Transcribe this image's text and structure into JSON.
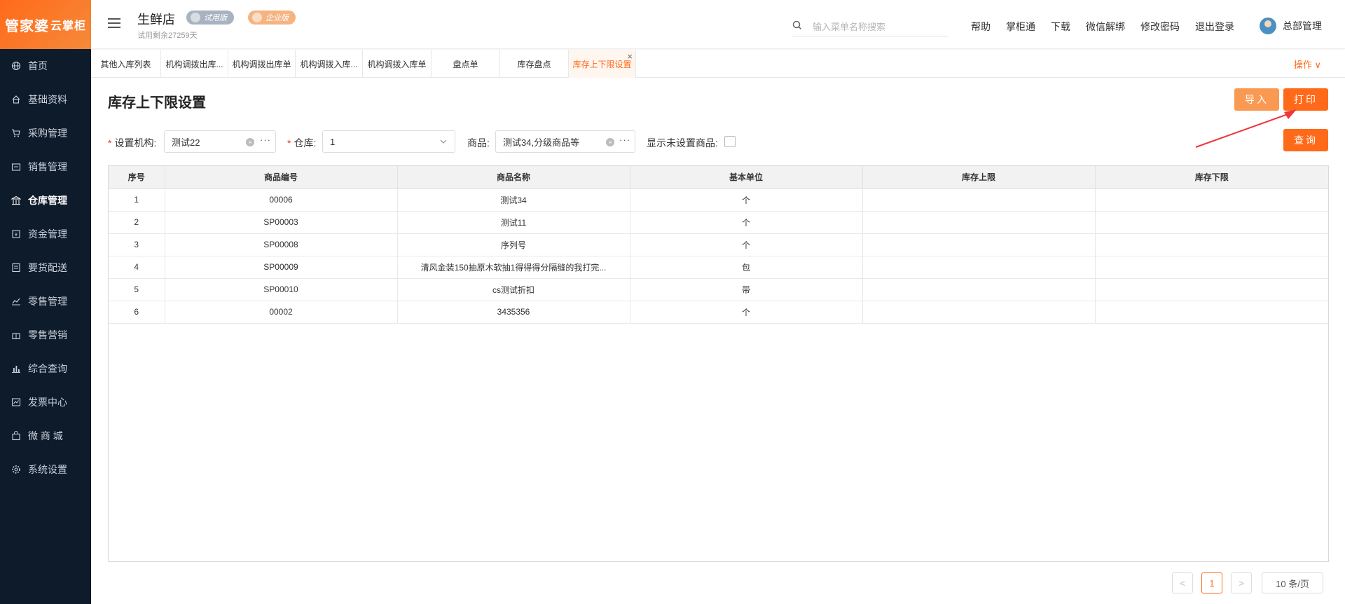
{
  "logo": {
    "main": "管家婆",
    "sub": "云掌柜"
  },
  "sidebar": {
    "items": [
      {
        "label": "首页",
        "icon": "globe-icon"
      },
      {
        "label": "基础资料",
        "icon": "home-icon"
      },
      {
        "label": "采购管理",
        "icon": "cart-icon"
      },
      {
        "label": "销售管理",
        "icon": "sales-icon"
      },
      {
        "label": "仓库管理",
        "icon": "warehouse-icon"
      },
      {
        "label": "资金管理",
        "icon": "money-icon"
      },
      {
        "label": "要货配送",
        "icon": "list-icon"
      },
      {
        "label": "零售管理",
        "icon": "chart-icon"
      },
      {
        "label": "零售营销",
        "icon": "gift-icon"
      },
      {
        "label": "综合查询",
        "icon": "bar-chart-icon"
      },
      {
        "label": "发票中心",
        "icon": "invoice-icon"
      },
      {
        "label": "微 商 城",
        "icon": "bag-icon"
      },
      {
        "label": "系统设置",
        "icon": "gear-icon"
      }
    ],
    "active_index": 4
  },
  "header": {
    "store_name": "生鲜店",
    "trial_badge": "试用版",
    "enterprise_badge": "企业版",
    "trial_remaining": "试用剩余27259天",
    "search_placeholder": "输入菜单名称搜索",
    "links": [
      "帮助",
      "掌柜通",
      "下载",
      "微信解绑",
      "修改密码",
      "退出登录"
    ],
    "user": "总部管理"
  },
  "tabs": {
    "items": [
      "其他入库列表",
      "机构调拨出库...",
      "机构调拨出库单",
      "机构调拨入库...",
      "机构调拨入库单",
      "盘点单",
      "库存盘点",
      "库存上下限设置"
    ],
    "active_index": 7,
    "ops_label": "操作 ∨"
  },
  "page": {
    "title": "库存上下限设置",
    "import_btn": "导入",
    "print_btn": "打印",
    "query_btn": "查询"
  },
  "filters": {
    "org_label": "设置机构:",
    "org_value": "测试22",
    "warehouse_label": "仓库:",
    "warehouse_value": "1",
    "product_label": "商品:",
    "product_value": "测试34,分级商品等",
    "show_unset_label": "显示未设置商品:"
  },
  "table": {
    "columns": [
      "序号",
      "商品编号",
      "商品名称",
      "基本单位",
      "库存上限",
      "库存下限"
    ],
    "rows": [
      [
        "1",
        "00006",
        "测试34",
        "个",
        "",
        ""
      ],
      [
        "2",
        "SP00003",
        "测试11",
        "个",
        "",
        ""
      ],
      [
        "3",
        "SP00008",
        "序列号",
        "个",
        "",
        ""
      ],
      [
        "4",
        "SP00009",
        "清风金装150抽原木软抽1得得得分隔缝的我打完...",
        "包",
        "",
        ""
      ],
      [
        "5",
        "SP00010",
        "cs测试折扣",
        "带",
        "",
        ""
      ],
      [
        "6",
        "00002",
        "3435356",
        "个",
        "",
        ""
      ]
    ]
  },
  "pagination": {
    "prev": "<",
    "current": "1",
    "next": ">",
    "page_size": "10 条/页"
  },
  "colors": {
    "accent": "#ff6a1a",
    "sidebar_bg": "#0e1b2b",
    "annotation_arrow": "#f0353b"
  }
}
